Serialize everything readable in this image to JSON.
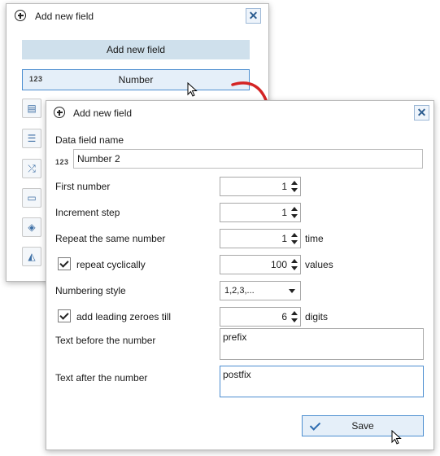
{
  "back_dialog": {
    "title": "Add new field",
    "close_glyph": "✕",
    "header_button": "Add new field",
    "number_item": {
      "icon_text": "123",
      "label": "Number"
    },
    "side_icons": [
      "csv-icon",
      "list-icon",
      "shuffle-icon",
      "ticket-icon",
      "layers-icon",
      "shapes-icon"
    ]
  },
  "front_dialog": {
    "title": "Add new field",
    "close_glyph": "✕",
    "data_field_label": "Data field name",
    "data_field_icon": "123",
    "data_field_value": "Number 2",
    "first_number": {
      "label": "First number",
      "value": "1"
    },
    "increment_step": {
      "label": "Increment step",
      "value": "1"
    },
    "repeat": {
      "label": "Repeat the same number",
      "value": "1",
      "unit": "time"
    },
    "repeat_cyclically": {
      "label": "repeat cyclically",
      "checked": true,
      "value": "100",
      "unit": "values"
    },
    "numbering_style": {
      "label": "Numbering style",
      "value": "1,2,3,..."
    },
    "leading_zeroes": {
      "label": "add leading zeroes till",
      "checked": true,
      "value": "6",
      "unit": "digits"
    },
    "text_before": {
      "label": "Text before the number",
      "value": "prefix"
    },
    "text_after": {
      "label": "Text after the number",
      "value": "postfix"
    },
    "save_label": "Save"
  },
  "colors": {
    "accent": "#4c8ed0",
    "arrow": "#d42424",
    "header_bg": "#cfe0ec"
  }
}
